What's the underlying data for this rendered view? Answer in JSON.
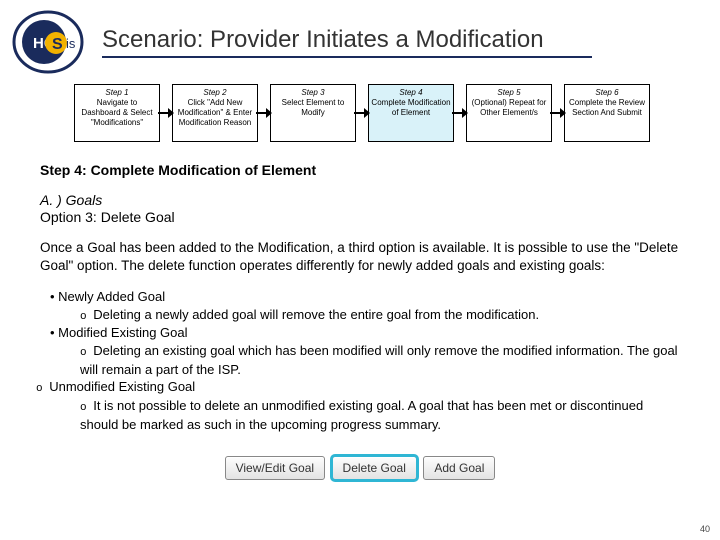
{
  "logo": {
    "abbr_left": "HC",
    "abbr_right": "is",
    "center": "S"
  },
  "title": "Scenario: Provider Initiates a Modification",
  "steps": [
    {
      "num": "Step 1",
      "desc": "Navigate to Dashboard & Select \"Modifications\""
    },
    {
      "num": "Step 2",
      "desc": "Click \"Add New Modification\" & Enter Modification Reason"
    },
    {
      "num": "Step 3",
      "desc": "Select Element to Modify"
    },
    {
      "num": "Step 4",
      "desc": "Complete Modification of Element"
    },
    {
      "num": "Step 5",
      "desc": "(Optional) Repeat for Other Element/s"
    },
    {
      "num": "Step 6",
      "desc": "Complete the Review Section And Submit"
    }
  ],
  "section_heading": "Step 4: Complete Modification of Element",
  "subhead": "A. ) Goals",
  "option": "Option 3: Delete Goal",
  "para": "Once a Goal has been added to the Modification, a third option is available. It is possible to use the \"Delete Goal\" option. The delete function operates differently for newly added goals and existing goals:",
  "bullets": {
    "b1a": "Newly Added Goal",
    "b2a": "Deleting a newly added goal will remove the entire goal from the modification.",
    "b1b": "Modified Existing Goal",
    "b2b": "Deleting an existing goal which has been modified will only remove the modified information. The goal will remain a part of the ISP.",
    "b0c": "Unmodified Existing Goal",
    "b2c": "It is not possible to delete an unmodified existing goal. A goal that has been met or discontinued should be marked as such in the upcoming progress summary."
  },
  "buttons": {
    "view": "View/Edit Goal",
    "delete": "Delete Goal",
    "add": "Add Goal"
  },
  "pagenum": "40"
}
